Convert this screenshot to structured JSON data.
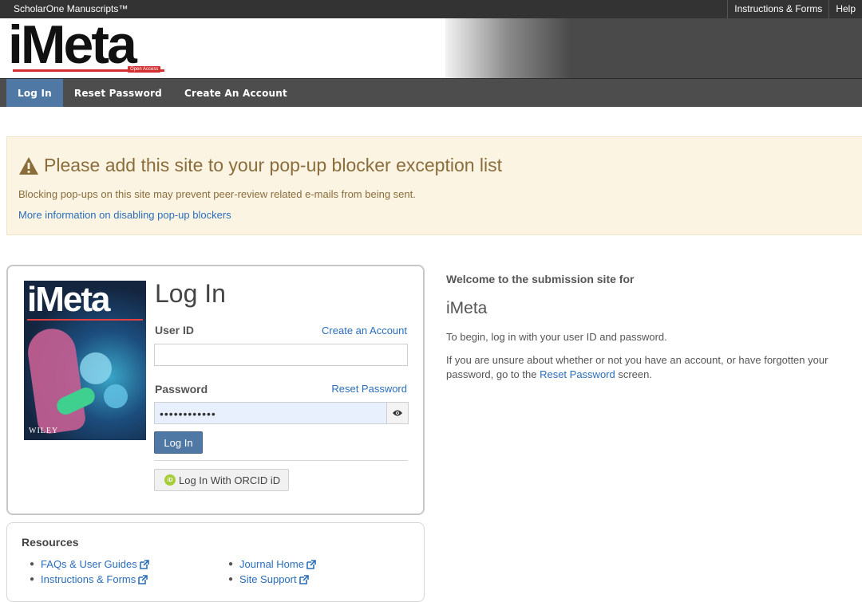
{
  "topbar": {
    "brand": "ScholarOne Manuscripts™",
    "links": [
      "Instructions & Forms",
      "Help"
    ]
  },
  "banner": {
    "logo_text": "iMeta",
    "logo_badge": "Open Access"
  },
  "nav": {
    "items": [
      "Log In",
      "Reset Password",
      "Create An Account"
    ],
    "active": "Log In"
  },
  "alert": {
    "title": "Please add this site to your pop-up blocker exception list",
    "message": "Blocking pop-ups on this site may prevent peer-review related e-mails from being sent.",
    "link": "More information on disabling pop-up blockers",
    "icon": "warning-triangle-icon",
    "color": "#8a6d3b"
  },
  "login": {
    "heading": "Log In",
    "cover_title": "iMeta",
    "cover_publisher": "WILEY",
    "user_id_label": "User ID",
    "create_account_link": "Create an Account",
    "user_id_value": "",
    "password_label": "Password",
    "reset_password_link": "Reset Password",
    "password_value": "••••••••••••",
    "login_button": "Log In",
    "orcid_button": "Log In With ORCID iD",
    "orcid_icon_text": "iD"
  },
  "resources": {
    "heading": "Resources",
    "left": [
      "FAQs & User Guides",
      "Instructions & Forms"
    ],
    "right": [
      "Journal Home",
      "Site Support"
    ]
  },
  "welcome": {
    "heading": "Welcome to the submission site for",
    "journal": "iMeta",
    "intro": "To begin, log in with your user ID and password.",
    "help_before": "If you are unsure about whether or not you have an account, or have forgotten your password, go to the ",
    "help_link": "Reset Password",
    "help_after": " screen."
  },
  "colors": {
    "accent": "#4f78a4",
    "link": "#2a6ebb",
    "alert_bg": "#fcf4e3"
  }
}
